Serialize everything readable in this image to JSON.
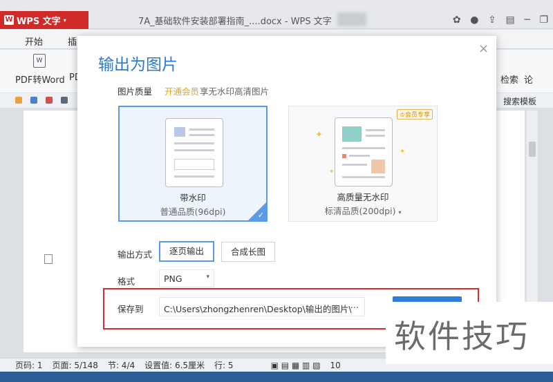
{
  "app": {
    "name": "WPS 文字",
    "doc_title": "7A_基础软件安装部署指南_....docx - WPS 文字"
  },
  "tabs": {
    "start": "开始",
    "insert_cut": "插"
  },
  "ribbon": {
    "pdf_word": "PDF转Word",
    "pdf_cut": "PD",
    "search_cut": "检索",
    "extra_cut": "论",
    "search_templates": "搜索模板"
  },
  "dialog": {
    "title": "输出为图片",
    "close": "×",
    "quality_label": "图片质量",
    "vip_link": "开通会员",
    "vip_desc": "享无水印高清图片",
    "cards": [
      {
        "title": "带水印",
        "subtitle": "普通品质(96dpi)",
        "selected": true
      },
      {
        "title": "高质量无水印",
        "subtitle": "标清品质(200dpi)",
        "badge": "会员专享",
        "selected": false
      }
    ],
    "mode_label": "输出方式",
    "mode_options": [
      "逐页输出",
      "合成长图"
    ],
    "format_label": "格式",
    "format_value": "PNG",
    "save_label": "保存到",
    "save_path": "C:\\Users\\zhongzhenren\\Desktop\\输出的图片\\",
    "browse": "..."
  },
  "statusbar": {
    "page_code": "页码: 1",
    "page": "页面: 5/148",
    "section": "节: 4/4",
    "setting": "设置值: 6.5厘米",
    "row": "行: 5",
    "zoom_cut": "10"
  },
  "watermark_text": "软件技巧",
  "colors": {
    "accent": "#2f7fd6",
    "vip": "#e9a21a",
    "annotation": "#d62b2b",
    "wps_red": "#cf2a27"
  }
}
